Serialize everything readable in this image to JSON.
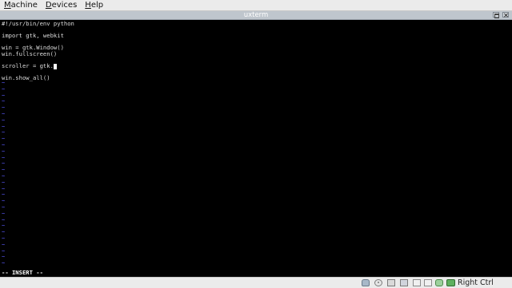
{
  "host_menu": {
    "items": [
      {
        "mnemonic": "M",
        "rest": "achine"
      },
      {
        "mnemonic": "D",
        "rest": "evices"
      },
      {
        "mnemonic": "H",
        "rest": "elp"
      }
    ]
  },
  "window": {
    "title": "uxterm"
  },
  "editor": {
    "lines": [
      "#!/usr/bin/env python",
      "",
      "import gtk, webkit",
      "",
      "win = gtk.Window()",
      "win.fullscreen()",
      "",
      "scroller = gtk.",
      "",
      "win.show_all()"
    ],
    "cursor_line_index": 7,
    "tilde_char": "~",
    "tilde_count": 30,
    "mode_text": "-- INSERT --",
    "tilde_color": "#5a5aff"
  },
  "host_status": {
    "icons": [
      "hard-disk-icon",
      "optical-drive-icon",
      "usb-icon",
      "network-icon",
      "shared-folders-icon",
      "display-icon",
      "mouse-integration-icon",
      "capture-arrow-icon"
    ],
    "host_key_label": "Right Ctrl"
  }
}
